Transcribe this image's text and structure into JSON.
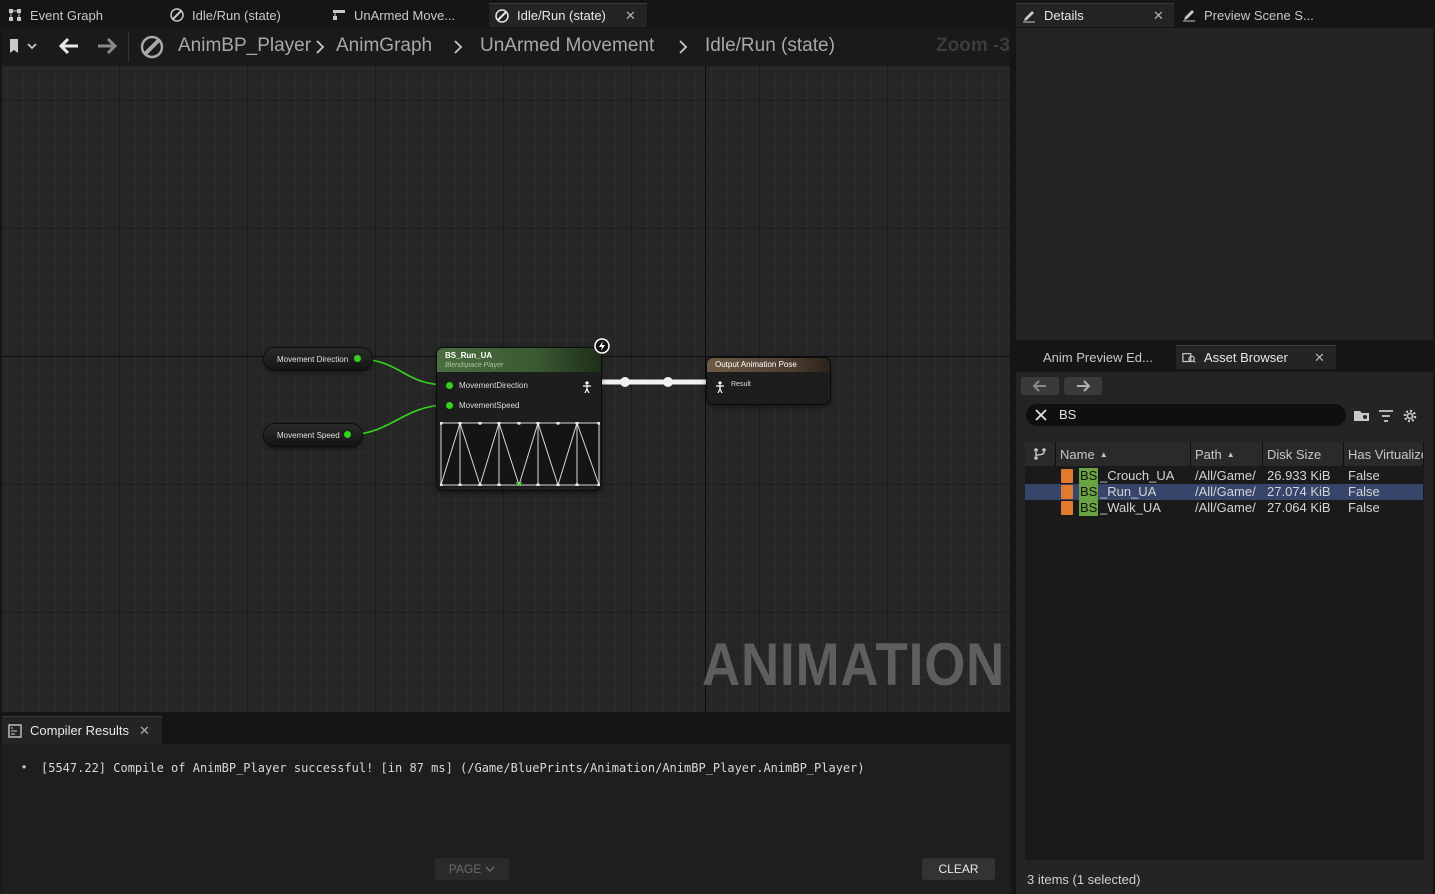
{
  "top_tabs": [
    {
      "label": "Event Graph"
    },
    {
      "label": "Idle/Run (state)"
    },
    {
      "label": "UnArmed Move..."
    },
    {
      "label": "Idle/Run (state)"
    }
  ],
  "right_tabs": {
    "details": "Details",
    "preview_scene": "Preview Scene S..."
  },
  "breadcrumb": {
    "items": [
      "AnimBP_Player",
      "AnimGraph",
      "UnArmed Movement",
      "Idle/Run (state)"
    ],
    "zoom": "Zoom -3"
  },
  "graph": {
    "watermark": "ANIMATION",
    "var_nodes": [
      {
        "label": "Movement Direction"
      },
      {
        "label": "Movement Speed"
      }
    ],
    "blendspace_node": {
      "title": "BS_Run_UA",
      "subtitle": "Blendspace Player",
      "pins": [
        "MovementDirection",
        "MovementSpeed"
      ]
    },
    "output_node": {
      "title": "Output Animation Pose",
      "pin": "Result"
    }
  },
  "compiler": {
    "tab_label": "Compiler Results",
    "message": "[5547.22] Compile of AnimBP_Player successful! [in 87 ms] (/Game/BluePrints/Animation/AnimBP_Player.AnimBP_Player)",
    "page_label": "PAGE",
    "clear_label": "CLEAR"
  },
  "lower_right_tabs": {
    "anim_preview": "Anim Preview Ed...",
    "asset_browser": "Asset Browser"
  },
  "asset_browser": {
    "search_value": "BS",
    "highlight_prefix": "BS",
    "columns": [
      "Name",
      "Path",
      "Disk Size",
      "Has Virtualize"
    ],
    "rows": [
      {
        "prefix": "BS",
        "name_rest": "_Crouch_UA",
        "path": "/All/Game/",
        "size": "26.933 KiB",
        "virtualized": "False",
        "selected": false
      },
      {
        "prefix": "BS",
        "name_rest": "_Run_UA",
        "path": "/All/Game/",
        "size": "27.074 KiB",
        "virtualized": "False",
        "selected": true
      },
      {
        "prefix": "BS",
        "name_rest": "_Walk_UA",
        "path": "/All/Game/",
        "size": "27.064 KiB",
        "virtualized": "False",
        "selected": false
      }
    ],
    "status": "3 items (1 selected)"
  },
  "colors": {
    "pin_green": "#34d21e",
    "highlight_green": "#6aa342",
    "selection_blue": "#37456b",
    "node_header_green": "#4a6e40"
  }
}
